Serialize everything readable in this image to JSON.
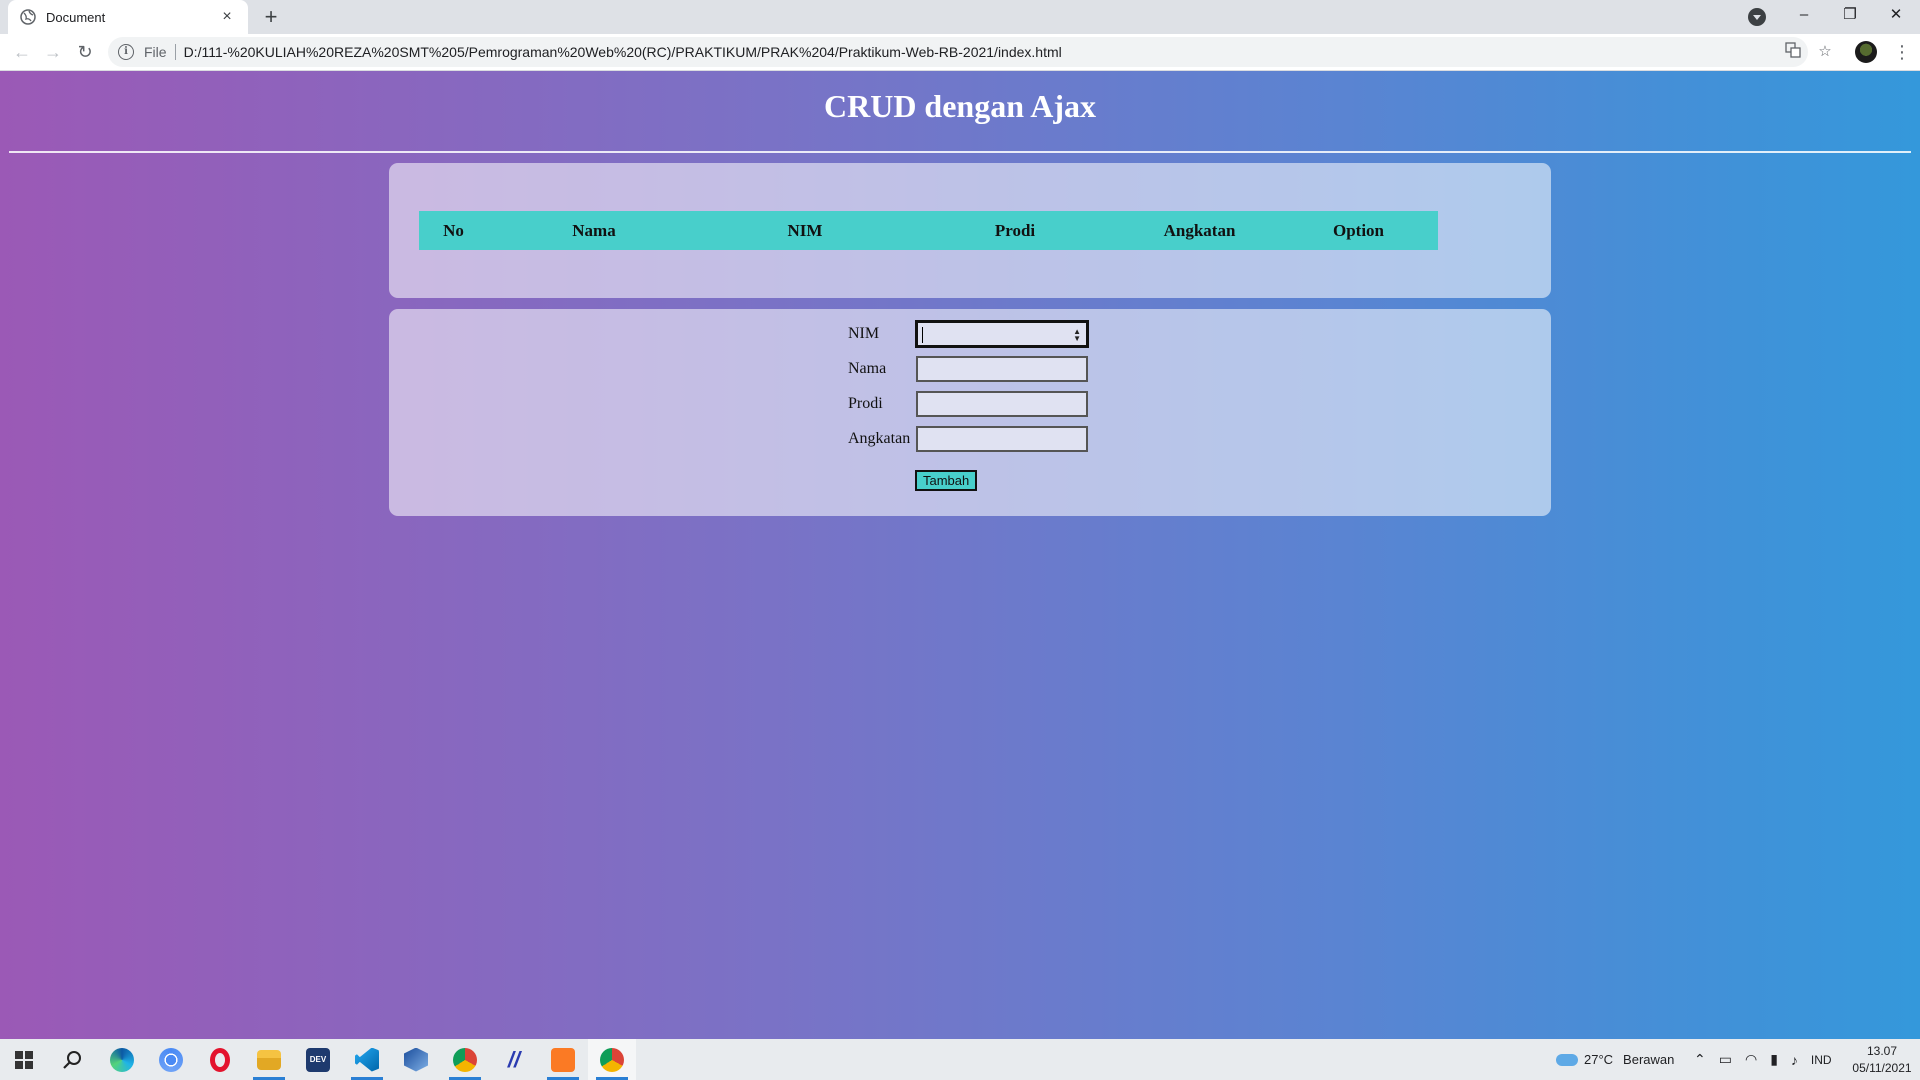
{
  "browser": {
    "tab_title": "Document",
    "tab_close": "×",
    "new_tab": "+",
    "address_scheme": "File",
    "url": "D:/111-%20KULIAH%20REZA%20SMT%205/Pemrograman%20Web%20(RC)/PRAKTIKUM/PRAK%204/Praktikum-Web-RB-2021/index.html",
    "window_controls": {
      "minimize": "–",
      "restore": "❐",
      "close": "✕"
    },
    "icons": [
      "back-icon",
      "forward-icon",
      "reload-icon",
      "info-icon",
      "translate-icon",
      "star-icon",
      "profile-avatar",
      "menu-icon"
    ]
  },
  "page": {
    "title": "CRUD dengan Ajax",
    "table": {
      "headers": [
        "No",
        "Nama",
        "NIM",
        "Prodi",
        "Angkatan",
        "Option"
      ],
      "rows": []
    },
    "form": {
      "nim_label": "NIM",
      "nama_label": "Nama",
      "prodi_label": "Prodi",
      "angkatan_label": "Angkatan",
      "nim_value": "",
      "nama_value": "",
      "prodi_value": "",
      "angkatan_value": "",
      "submit_label": "Tambah"
    }
  },
  "taskbar": {
    "apps": [
      "start-icon",
      "search-icon",
      "edge-icon",
      "chrome-icon",
      "opera-icon",
      "file-explorer-icon",
      "devcpp-icon",
      "vscode-icon",
      "virtualbox-icon",
      "chrome-profile-icon",
      "csharp-icon",
      "xampp-icon",
      "chrome-active-icon"
    ],
    "weather_temp": "27°C",
    "weather_desc": "Berawan",
    "language": "IND",
    "time": "13.07",
    "date": "05/11/2021"
  },
  "colors": {
    "gradient_start": "#9b59b6",
    "gradient_end": "#3498db",
    "table_header_bg": "#48cfcb",
    "button_bg": "#48cfcb"
  }
}
